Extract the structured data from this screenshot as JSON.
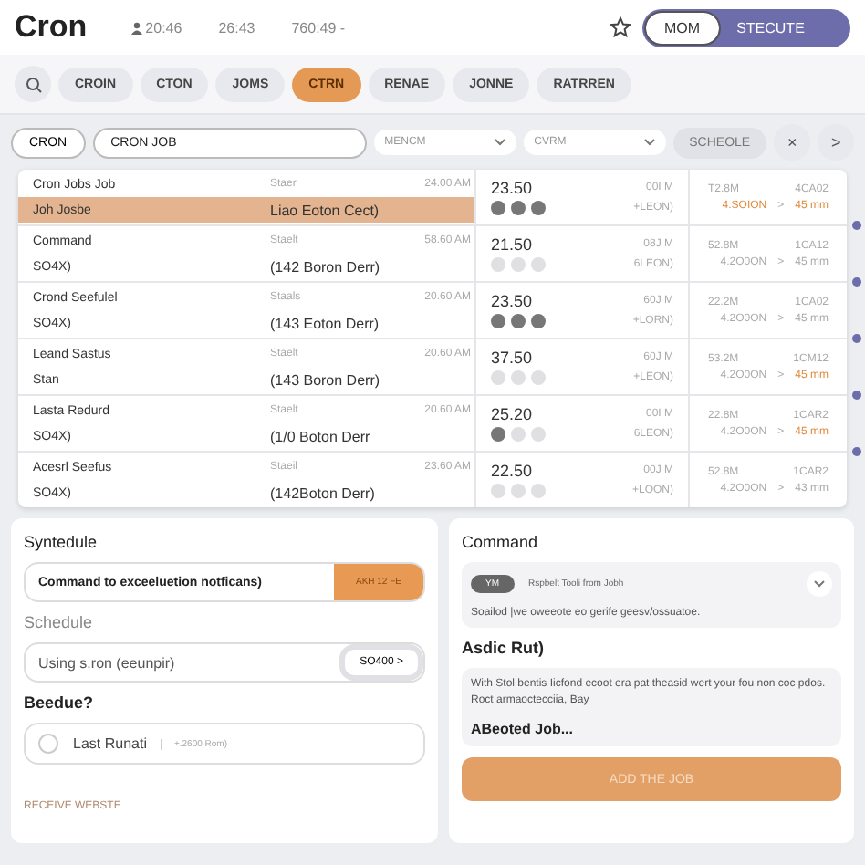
{
  "header": {
    "title": "Cron",
    "stats": [
      "20:46",
      "26:43",
      "760:49 -"
    ],
    "modes": [
      {
        "label": "MOM",
        "selected": true
      },
      {
        "label": "STECUTE",
        "selected": false
      }
    ]
  },
  "chips": [
    {
      "label": "CROIN",
      "selected": false
    },
    {
      "label": "CTON",
      "selected": false
    },
    {
      "label": "JOMS",
      "selected": false
    },
    {
      "label": "CTRN",
      "selected": true
    },
    {
      "label": "RENAE",
      "selected": false
    },
    {
      "label": "JONNE",
      "selected": false
    },
    {
      "label": "RATRREN",
      "selected": false
    }
  ],
  "toolbar": {
    "scope": "CRON",
    "query": "CRON JOB",
    "dropdowns": [
      "MENCM",
      "CVRM"
    ],
    "schedule_button": "SCHEOLE",
    "close_button": "×",
    "next_button": ">"
  },
  "rows": [
    {
      "name": "Cron Jobs Job",
      "sub": "Joh Josbe",
      "state": "Staer",
      "time": "24.00 AM",
      "host": "Liao Eoton Cect)",
      "value": "23.50",
      "unit": "00I M",
      "stars": 3,
      "code": "+LEON)",
      "size": "T2.8M",
      "ref": "4CA02",
      "range": "4.SOION",
      "arrow": ">",
      "duration": "45 mm",
      "selected": true,
      "alert": true
    },
    {
      "name": "Command",
      "sub": "SO4X)",
      "state": "Staelt",
      "time": "58.60 AM",
      "host": "(142 Boron Derr)",
      "value": "21.50",
      "unit": "08J M",
      "stars": 0,
      "code": "6LEON)",
      "size": "52.8M",
      "ref": "1CA12",
      "range": "4.2O0ON",
      "arrow": ">",
      "duration": "45 mm",
      "selected": false,
      "alert": false
    },
    {
      "name": "Crond Seefulel",
      "sub": "SO4X)",
      "state": "Staals",
      "time": "20.60 AM",
      "host": "(143 Eoton Derr)",
      "value": "23.50",
      "unit": "60J M",
      "stars": 3,
      "code": "+LORN)",
      "size": "22.2M",
      "ref": "1CA02",
      "range": "4.2O0ON",
      "arrow": ">",
      "duration": "45 mm",
      "selected": false,
      "alert": false
    },
    {
      "name": "Leand Sastus",
      "sub": "Stan",
      "state": "Staelt",
      "time": "20.60 AM",
      "host": "(143 Boron Derr)",
      "value": "37.50",
      "unit": "60J M",
      "stars": 0,
      "code": "+LEON)",
      "size": "53.2M",
      "ref": "1CM12",
      "range": "4.2O0ON",
      "arrow": ">",
      "duration": "45 mm",
      "selected": false,
      "alert": true
    },
    {
      "name": "Lasta Redurd",
      "sub": "SO4X)",
      "state": "Staelt",
      "time": "20.60 AM",
      "host": "(1/0 Boton Derr",
      "value": "25.20",
      "unit": "00I M",
      "stars": 1,
      "code": "6LEON)",
      "size": "22.8M",
      "ref": "1CAR2",
      "range": "4.2O0ON",
      "arrow": ">",
      "duration": "45 mm",
      "selected": false,
      "alert": true
    },
    {
      "name": "Acesrl Seefus",
      "sub": "SO4X)",
      "state": "Staeil",
      "time": "23.60 AM",
      "host": "(142Boton Derr)",
      "value": "22.50",
      "unit": "00J M",
      "stars": 0,
      "code": "+LOON)",
      "size": "52.8M",
      "ref": "1CAR2",
      "range": "4.2O0ON",
      "arrow": ">",
      "duration": "43 mm",
      "selected": false,
      "alert": false
    }
  ],
  "schedule_panel": {
    "title": "Syntedule",
    "command_field": "Command to exceeluetion notficans)",
    "command_button": "AKH 12 FE",
    "schedule_label": "Schedule",
    "schedule_field": "Using s.ron (eeunpir)",
    "schedule_button": "SO400 >",
    "question": "Beedue?",
    "option": {
      "label": "Last Runati",
      "detail": "+.2600 Rom)",
      "checked": false
    },
    "link": "RECEIVE WEBSTE"
  },
  "command_panel": {
    "title": "Command",
    "tag": "YM",
    "selected_command": "Rspbelt Tooli from Jobh",
    "hint": "Soailod |we oweeote eo gerife geesv/ossuatoe.",
    "notes_label": "Asdic Rut)",
    "notes": "With Stol bentis Iicfond ecoot era pat theasid wert your fou non coc pdos. Roct armaoctecciia, Bay",
    "added": "ABeoted Job...",
    "submit": "ADD THE JOB"
  }
}
